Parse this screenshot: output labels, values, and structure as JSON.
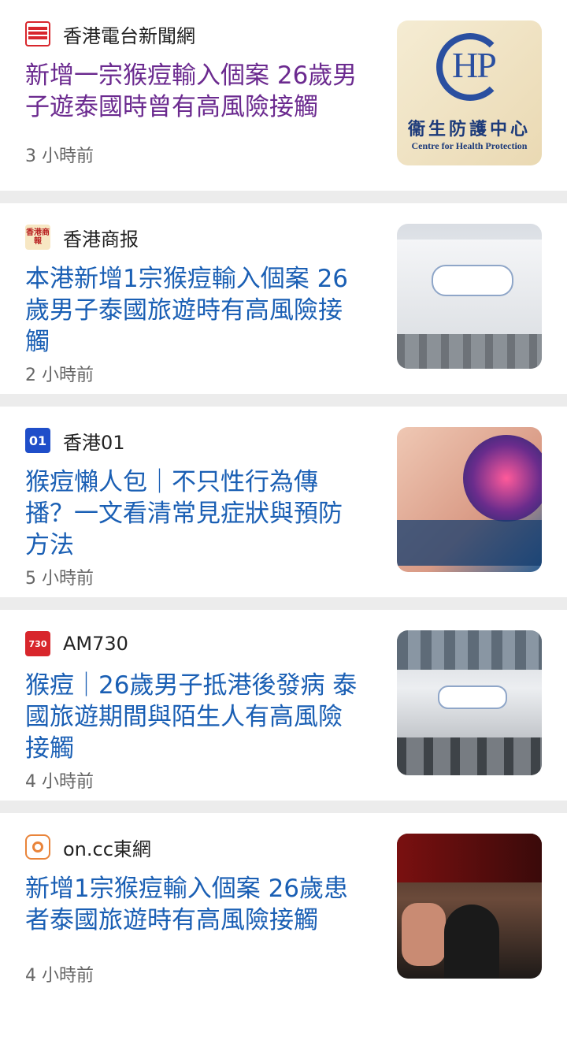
{
  "articles": [
    {
      "source": "香港電台新聞網",
      "headline": "新增一宗猴痘輸入個案 26歲男子遊泰國時曾有高風險接觸",
      "time": "3 小時前",
      "thumb": {
        "hp": "HP",
        "zh": "衞生防護中心",
        "en": "Centre for Health Protection"
      }
    },
    {
      "source": "香港商报",
      "headline": "本港新增1宗猴痘輸入個案 26歲男子泰國旅遊時有高風險接觸",
      "time": "2 小時前"
    },
    {
      "source": "香港01",
      "headline": "猴痘懶人包｜不只性行為傳播？一文看清常見症狀與預防方法",
      "time": "5 小時前"
    },
    {
      "source": "AM730",
      "headline": "猴痘｜26歲男子抵港後發病 泰國旅遊期間與陌生人有高風險接觸",
      "time": "4 小時前"
    },
    {
      "source": "on.cc東網",
      "headline": "新增1宗猴痘輸入個案 26歲患者泰國旅遊時有高風險接觸",
      "time": "4 小時前"
    }
  ],
  "logos": {
    "hkcd": "香港商報",
    "hk01": "01",
    "am730": "730"
  },
  "colors": {
    "headline": "#1a5fb4",
    "headline_visited": "#6b2a8f",
    "separator": "#ececec",
    "meta": "#666666"
  }
}
